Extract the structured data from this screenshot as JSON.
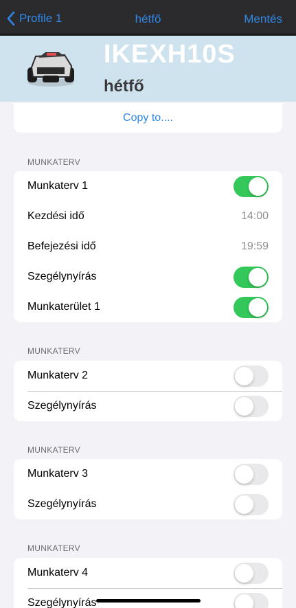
{
  "navbar": {
    "back_label": "Profile 1",
    "title": "hétfő",
    "save_label": "Mentés"
  },
  "header": {
    "device_name": "IKEXH10S",
    "day": "hétfő"
  },
  "copy": {
    "label": "Copy to...."
  },
  "sections": [
    {
      "header": "MUNKATERV",
      "rows": [
        {
          "label": "Munkaterv 1",
          "toggle": true
        },
        {
          "label": "Kezdési idő",
          "value": "14:00"
        },
        {
          "label": "Befejezési idő",
          "value": "19:59"
        },
        {
          "label": "Szegélynyírás",
          "toggle": true
        },
        {
          "label": "Munkaterület 1",
          "toggle": true
        }
      ]
    },
    {
      "header": "MUNKATERV",
      "rows": [
        {
          "label": "Munkaterv 2",
          "toggle": false
        },
        {
          "label": "Szegélynyírás",
          "toggle": false
        }
      ]
    },
    {
      "header": "MUNKATERV",
      "rows": [
        {
          "label": "Munkaterv 3",
          "toggle": false
        },
        {
          "label": "Szegélynyírás",
          "toggle": false
        }
      ]
    },
    {
      "header": "MUNKATERV",
      "rows": [
        {
          "label": "Munkaterv 4",
          "toggle": false
        },
        {
          "label": "Szegélynyírás",
          "toggle": false
        }
      ]
    }
  ],
  "colors": {
    "accent": "#2f86e6",
    "toggle_on": "#34c759",
    "toggle_off": "#e9e9eb",
    "header_bg": "#cfe3ee"
  },
  "icons": {
    "back": "chevron-left-icon",
    "device": "robot-mower-image"
  }
}
